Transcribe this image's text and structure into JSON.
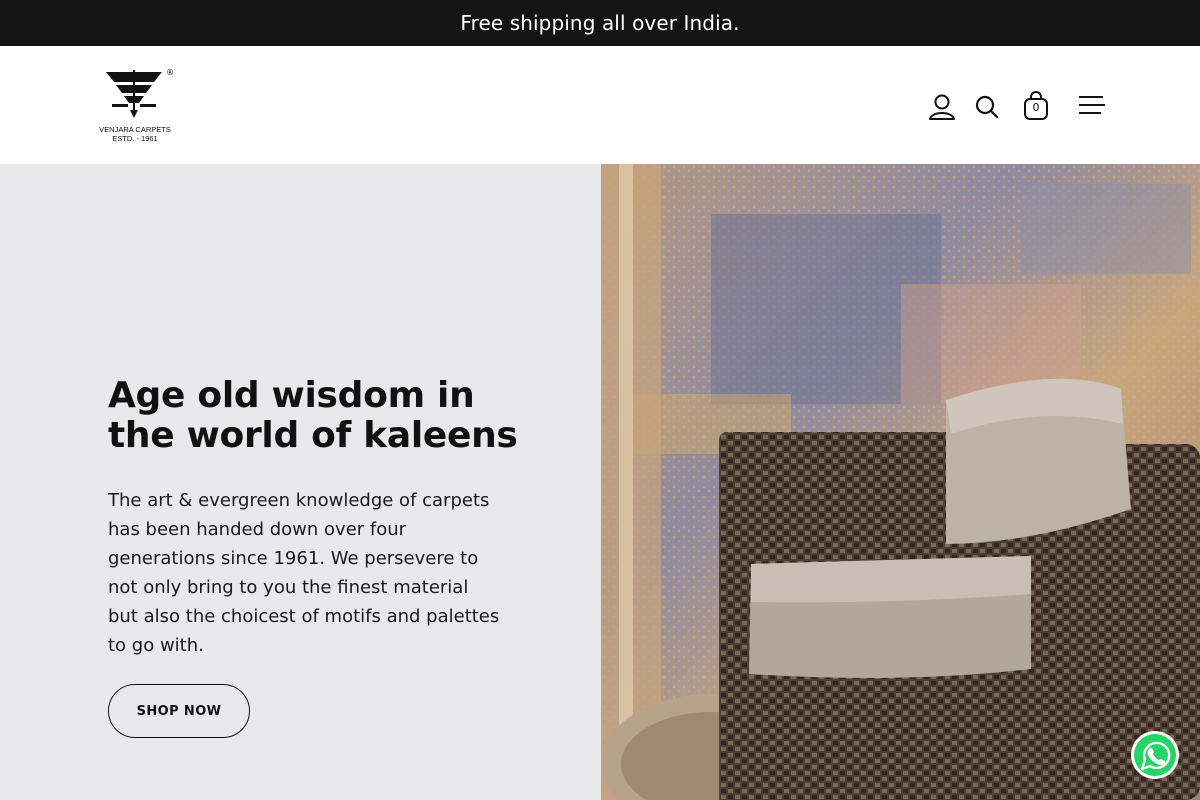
{
  "announcement": {
    "text": "Free shipping all over India."
  },
  "logo": {
    "name": "VENJARA CARPETS",
    "estd": "ESTD. - 1961",
    "mark": "®"
  },
  "header": {
    "icons": [
      "account-icon",
      "search-icon",
      "cart-icon",
      "menu-icon"
    ],
    "cart_count": "0"
  },
  "hero": {
    "title": "Age old wisdom in the world of kaleens",
    "body": "The art & evergreen knowledge of carpets has been handed down over four generations since 1961. We persevere to not only bring to you the finest material but also the choicest of motifs and palettes to go with.",
    "cta_label": "SHOP NOW"
  },
  "colors": {
    "announcement_bg": "#141414",
    "hero_left_bg": "#e9e9ec",
    "whatsapp": "#25d366"
  }
}
